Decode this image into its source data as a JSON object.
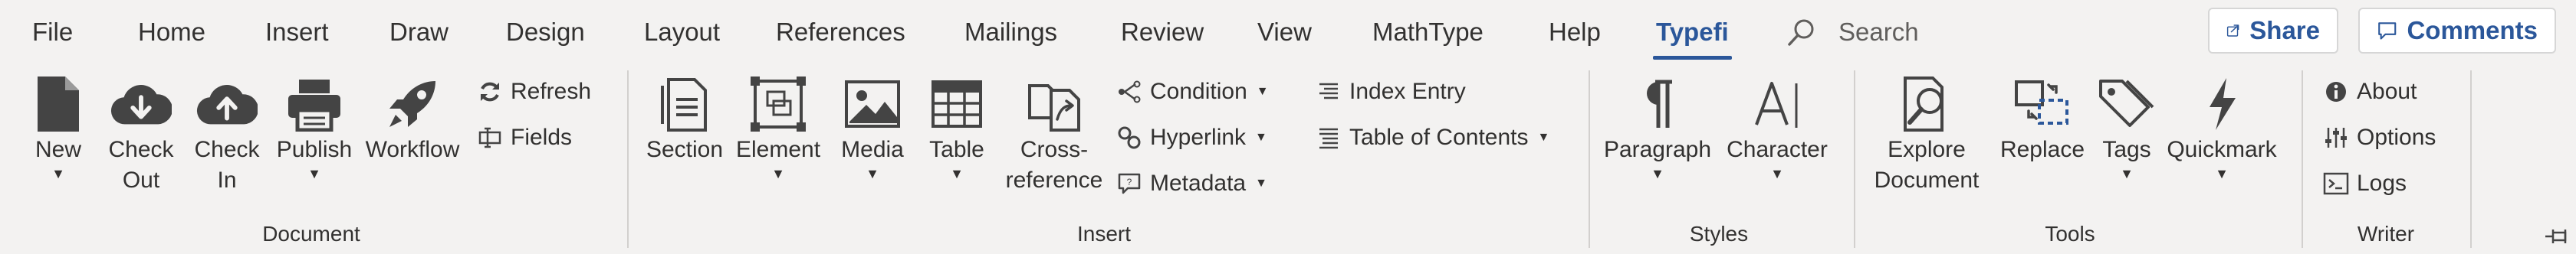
{
  "tabs": [
    "File",
    "Home",
    "Insert",
    "Draw",
    "Design",
    "Layout",
    "References",
    "Mailings",
    "Review",
    "View",
    "MathType",
    "Help",
    "Typefi"
  ],
  "active_tab": "Typefi",
  "search": {
    "label": "Search"
  },
  "share": {
    "label": "Share"
  },
  "comments": {
    "label": "Comments"
  },
  "groups": {
    "document": {
      "label": "Document",
      "new": "New",
      "check_out": [
        "Check",
        "Out"
      ],
      "check_in": [
        "Check",
        "In"
      ],
      "publish": "Publish",
      "workflow": "Workflow",
      "refresh": "Refresh",
      "fields": "Fields"
    },
    "insert": {
      "label": "Insert",
      "section": "Section",
      "element": "Element",
      "media": "Media",
      "table": "Table",
      "cross_reference": [
        "Cross-",
        "reference"
      ],
      "condition": "Condition",
      "hyperlink": "Hyperlink",
      "metadata": "Metadata",
      "index_entry": "Index Entry",
      "toc": "Table of Contents"
    },
    "styles": {
      "label": "Styles",
      "paragraph": "Paragraph",
      "character": "Character"
    },
    "tools": {
      "label": "Tools",
      "explore": [
        "Explore",
        "Document"
      ],
      "replace": "Replace",
      "tags": "Tags",
      "quickmark": "Quickmark"
    },
    "writer": {
      "label": "Writer",
      "about": "About",
      "options": "Options",
      "logs": "Logs"
    }
  },
  "colors": {
    "accent": "#2b579a",
    "icon": "#444444",
    "ribbon_bg": "#f3f2f1"
  }
}
